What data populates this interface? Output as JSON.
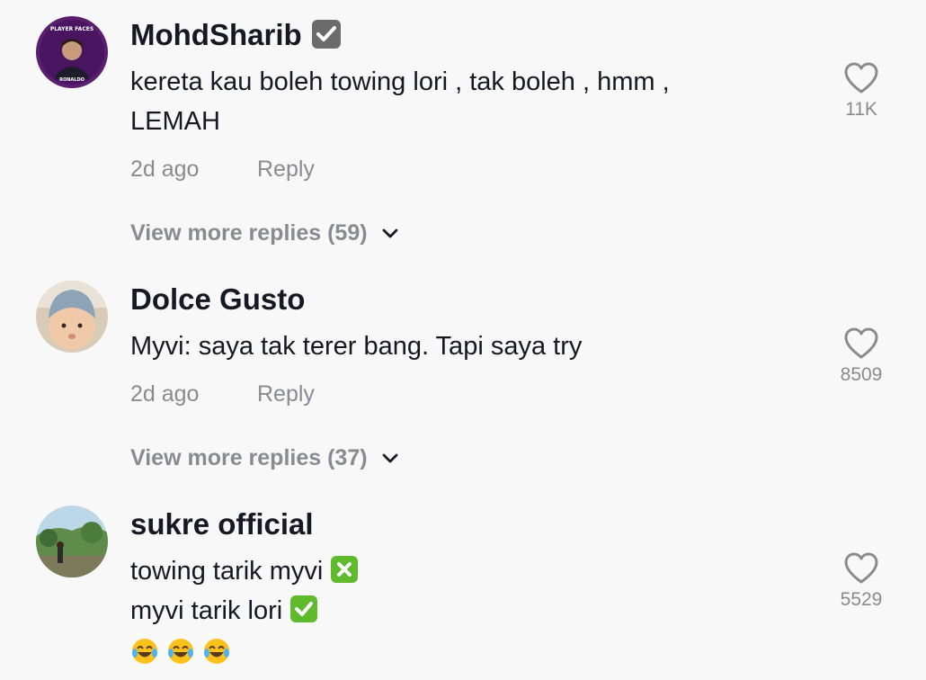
{
  "colors": {
    "background": "#f8f8f8",
    "text": "#161823",
    "muted": "#8a8b91",
    "check_green": "#5fbb2c"
  },
  "comments": [
    {
      "username": "MohdSharib",
      "verified": true,
      "avatar": "player-faces-ronaldo-avatar",
      "avatar_text": {
        "top": "PLAYER FACES",
        "bottom": "RONALDO"
      },
      "lines": [
        "kereta kau boleh towing lori , tak boleh , hmm ,",
        "LEMAH"
      ],
      "time": "2d ago",
      "reply_label": "Reply",
      "view_replies": "View more replies (59)",
      "likes": "11K"
    },
    {
      "username": "Dolce Gusto",
      "verified": false,
      "avatar": "baby-photo-avatar",
      "lines": [
        "Myvi: saya tak terer bang. Tapi saya try"
      ],
      "time": "2d ago",
      "reply_label": "Reply",
      "view_replies": "View more replies (37)",
      "likes": "8509"
    },
    {
      "username": "sukre official",
      "verified": false,
      "avatar": "outdoor-garden-photo-avatar",
      "lines": [
        "towing tarik myvi",
        "myvi tarik lori"
      ],
      "line_emojis": [
        "cross-mark-emoji",
        "check-mark-emoji"
      ],
      "extra_emojis": [
        "face-with-tears-of-joy",
        "face-with-tears-of-joy",
        "face-with-tears-of-joy"
      ],
      "likes": "5529"
    }
  ]
}
